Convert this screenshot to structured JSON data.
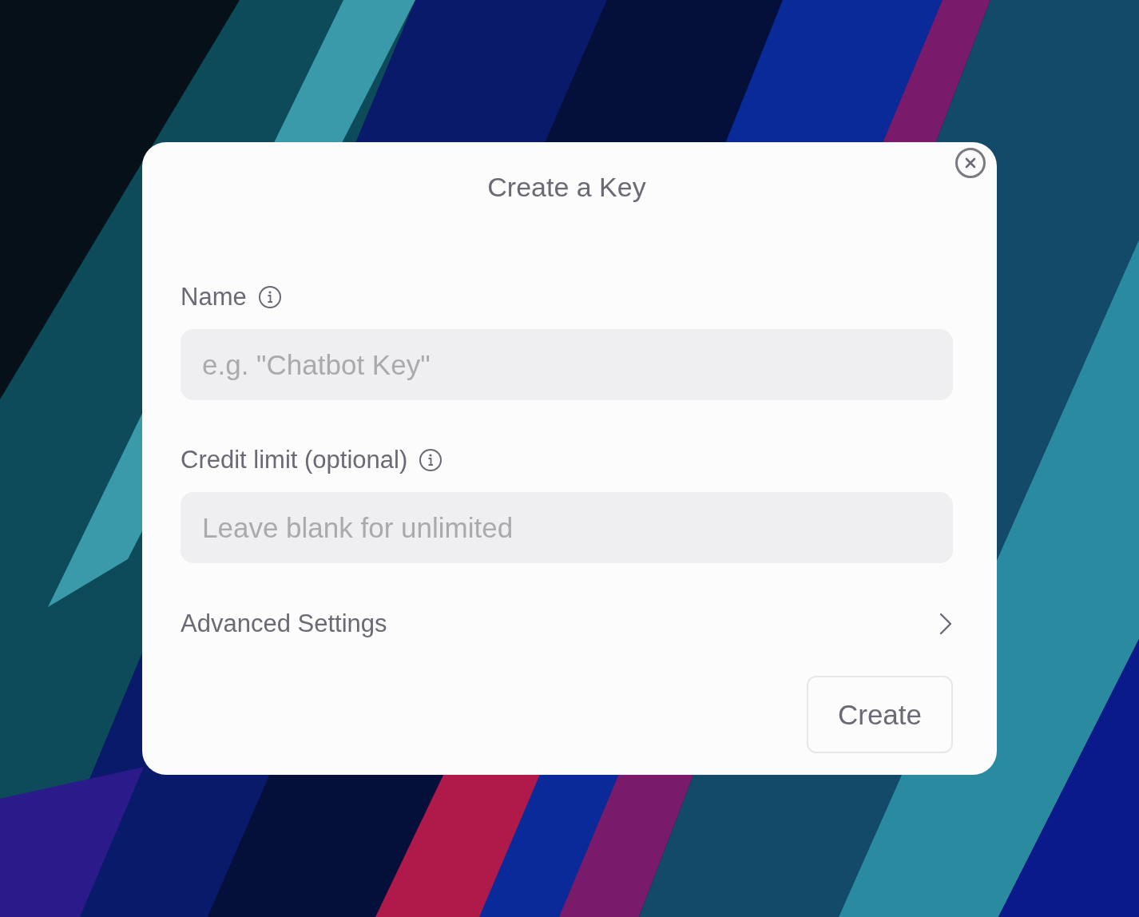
{
  "dialog": {
    "title": "Create a Key"
  },
  "fields": [
    {
      "label": "Name",
      "placeholder": "e.g. \"Chatbot Key\""
    },
    {
      "label": "Credit limit (optional)",
      "placeholder": "Leave blank for unlimited"
    }
  ],
  "advanced_settings": {
    "label": "Advanced Settings",
    "expanded": false
  },
  "create_button": {
    "label": "Create"
  }
}
